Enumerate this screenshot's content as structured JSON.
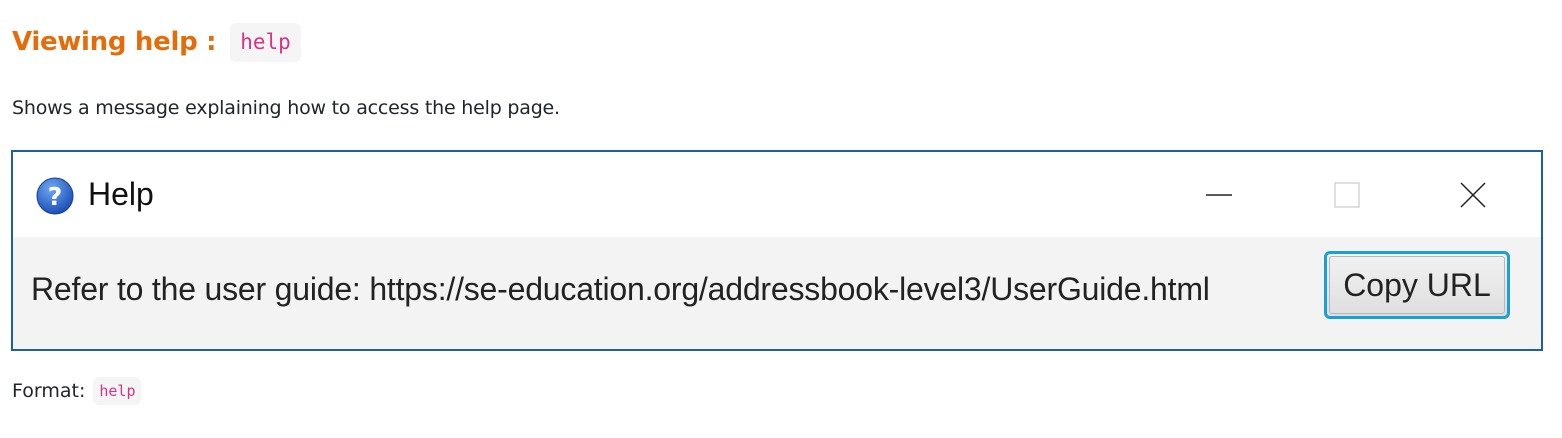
{
  "heading": {
    "text": "Viewing help :",
    "command": "help"
  },
  "description": "Shows a message explaining how to access the help page.",
  "window": {
    "title": "Help",
    "icon": "question-mark-icon",
    "controls": [
      "minimize-icon",
      "maximize-icon",
      "close-icon"
    ],
    "message": "Refer to the user guide: https://se-education.org/addressbook-level3/UserGuide.html",
    "copy_button_label": "Copy URL",
    "colors": {
      "frame_border": "#1d5fa0",
      "button_focus": "#1aa0d8",
      "content_background": "#f3f3f3"
    }
  },
  "format": {
    "label": "Format:",
    "command": "help"
  },
  "colors": {
    "heading": "#e46c0a",
    "code_text": "#d63384",
    "code_background": "#f5f5f5"
  }
}
